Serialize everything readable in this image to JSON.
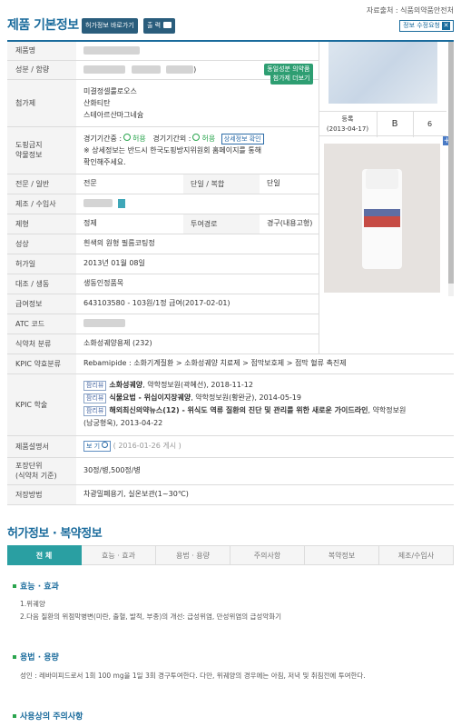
{
  "header": {
    "title": "제품 기본정보",
    "btn_permit": "허가정보 바로가기",
    "btn_print": "출 력",
    "source": "자료출처 : 식품의약품안전처",
    "btn_edit": "정보 수정요청"
  },
  "table": {
    "product_name_label": "제품명",
    "ingredient_label": "성분 / 함량",
    "ingredient_value_tail": ")",
    "btn_same_ingredient": "동일성분 의약품",
    "additive_label": "첨가제",
    "additives": [
      "미결정셀룰로오스",
      "산화티탄",
      "스테아르산마그네슘"
    ],
    "btn_more_additives": "첨가제 더보기",
    "doping_label": [
      "도핑금지",
      "약물정보"
    ],
    "doping_in": "경기기간중 :",
    "doping_in_status": "허용",
    "doping_out": "경기기간외 :",
    "doping_out_status": "허용",
    "btn_doping_detail": "상세정보 확인",
    "doping_note": "※ 상세정보는 반드시 한국도핑방지위원회 홈페이지를 통해",
    "doping_note2": "확인해주세요.",
    "spec_label": "전문 / 일반",
    "spec_value": "전문",
    "single_label": "단일 / 복합",
    "single_value": "단일",
    "maker_label": "제조 / 수입사",
    "form_label": "제형",
    "form_value": "정제",
    "route_label": "투여경로",
    "route_value": "경구(내용고형)",
    "shape_label": "성상",
    "shape_value": "흰색의 원형 필름코팅정",
    "permit_label": "허가일",
    "permit_value": "2013년 01월 08일",
    "contrast_label": "대조 / 생동",
    "contrast_value": "생동인정품목",
    "benefit_label": "급여정보",
    "benefit_value": "643103580 - 103원/1정 급여(2017-02-01)",
    "atc_label": "ATC 코드",
    "mfds_label": "식약처 분류",
    "mfds_value": "소화성궤양용제 (232)",
    "kpic_class_label": "KPIC 약효분류",
    "kpic_class_value": "Rebamipide : 소화기계질환 > 소화성궤양 치료제 > 점막보호제 > 점막 혈류 촉진제",
    "kpic_label": "KPIC 학술",
    "kpic_items": [
      {
        "tag": "팜리뷰",
        "title": "소화성궤양",
        "rest": ", 약학정보원(곽혜선), 2018-11-12",
        "rest2": ""
      },
      {
        "tag": "팜리뷰",
        "title": "식물요법 - 위십이지장궤양",
        "rest": ", 약학정보원(황완균), 2014-05-19",
        "rest2": ""
      },
      {
        "tag": "팜리뷰",
        "title": "해외최신의약뉴스(12) - 위식도 역류 질환의 진단 및 관리를 위한 새로운 가이드라인",
        "rest": ", 약학정보원",
        "rest2": "(남궁형욱), 2013-04-22"
      }
    ],
    "manual_label": "제품설명서",
    "manual_btn": "보 기",
    "manual_date": "( 2016-01-26 게시 )",
    "pack_label": [
      "포장단위",
      "(식약처 기준)"
    ],
    "pack_value": "30정/병,500정/병",
    "storage_label": "저장방법",
    "storage_value": "차광밀폐용기, 실온보관(1~30℃)"
  },
  "image_panel": {
    "reg_label": "등록",
    "reg_date": "(2013-04-17)",
    "reg_icon": "B",
    "reg_count": "6",
    "plus": "+"
  },
  "section2": {
    "title": "허가정보 · 복약정보",
    "tabs": [
      "전 체",
      "효능 · 효과",
      "용법 · 용량",
      "주의사항",
      "복약정보",
      "제조/수입사"
    ],
    "efficacy_title": "효능 · 효과",
    "efficacy_lines": [
      "1.위궤양",
      "2.다음 질환의 위점막병변(미란, 출혈, 발적, 부종)의 개선: 급성위염, 만성위염의 급성악화기"
    ],
    "dosage_title": "용법 · 용량",
    "dosage_text": "성인 : 레바미피드로서 1회 100 mg을 1일 3회 경구투여한다. 다만, 위궤양의 경우에는 아침, 저녁 및 취침전에 투여한다.",
    "caution_title": "사용상의 주의사항"
  },
  "colors": {
    "brand_blue": "#1a6b9c",
    "tab_active": "#2a9fa2",
    "green_btn": "#2e9e72",
    "allow_green": "#2aa54e"
  }
}
